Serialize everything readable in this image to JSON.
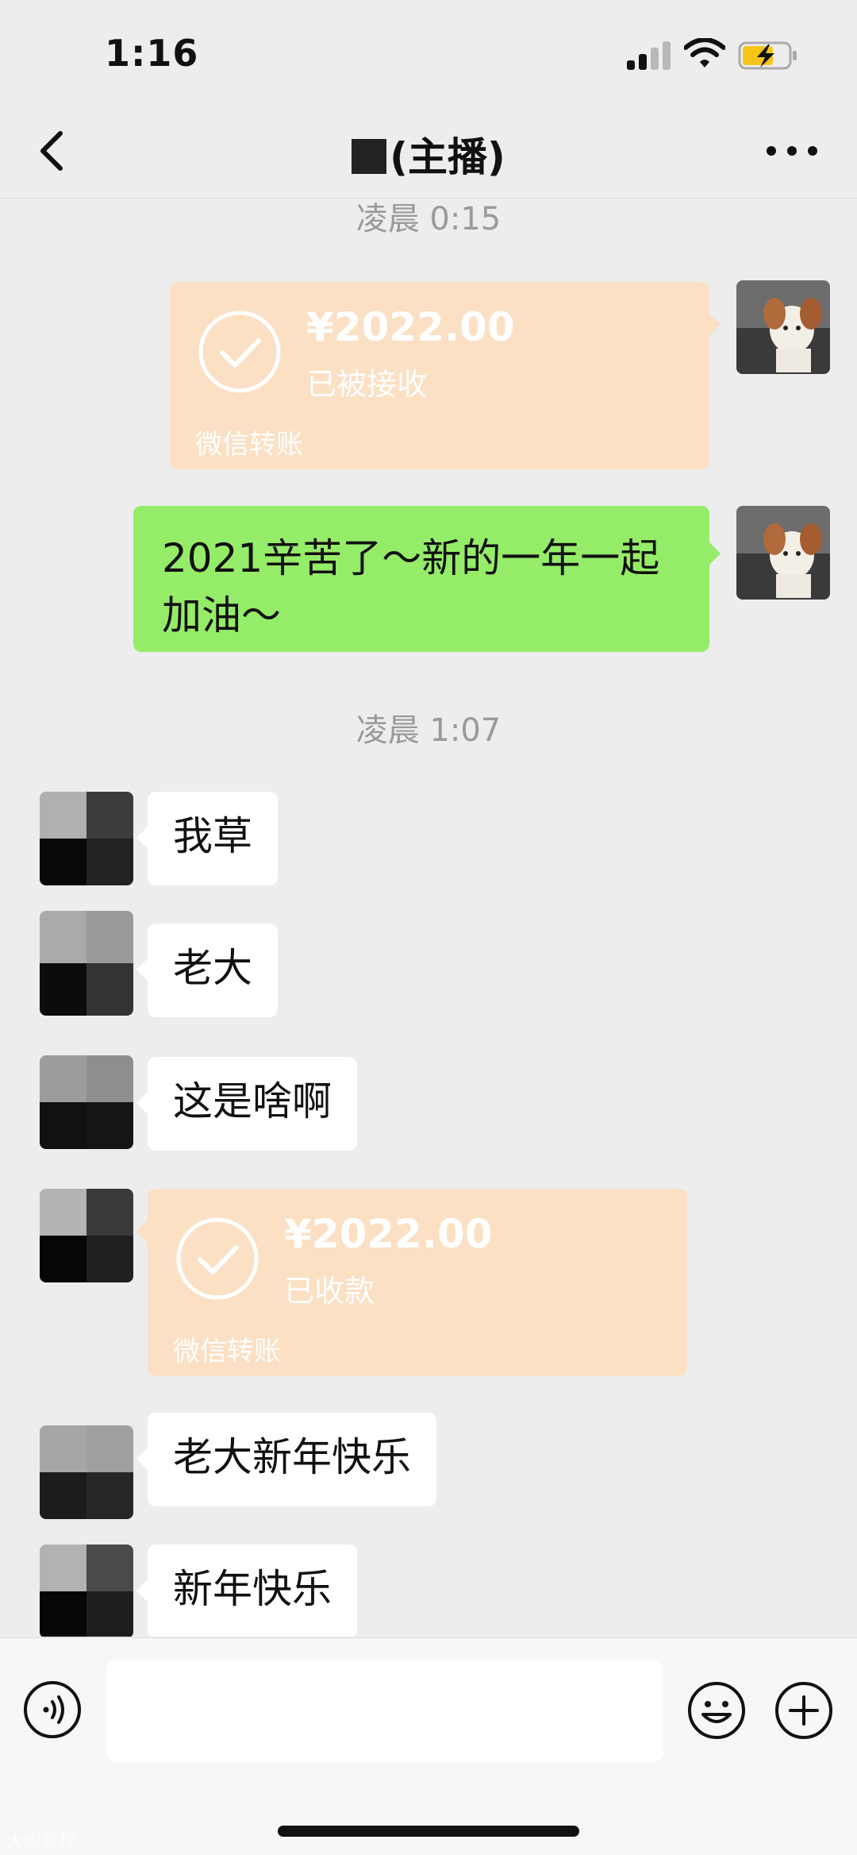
{
  "status_bar": {
    "time": "1:16"
  },
  "nav": {
    "title": "(主播)",
    "back_icon": "chevron-left-icon",
    "more_icon": "more-dots-icon"
  },
  "messages": {
    "timestamp_1": "凌晨 0:15",
    "sent_transfer": {
      "amount": "¥2022.00",
      "status": "已被接收",
      "brand": "微信转账"
    },
    "sent_text": {
      "line1": "2021辛苦了～新的一年一起",
      "line2": "加油～"
    },
    "timestamp_2": "凌晨 1:07",
    "received_1": "我草",
    "received_2": "老大",
    "received_3": "这是啥啊",
    "received_transfer": {
      "amount": "¥2022.00",
      "status": "已收款",
      "brand": "微信转账"
    },
    "received_4": "老大新年快乐",
    "received_5": "新年快乐"
  },
  "input_bar": {
    "placeholder": "",
    "voice_icon": "voice-icon",
    "emoji_icon": "emoji-icon",
    "plus_icon": "plus-icon"
  },
  "watermark": "大眼看视",
  "colors": {
    "background": "#ededed",
    "sent_bubble": "#95ec69",
    "transfer_card": "#fbe0c4",
    "received_bubble": "#ffffff"
  }
}
